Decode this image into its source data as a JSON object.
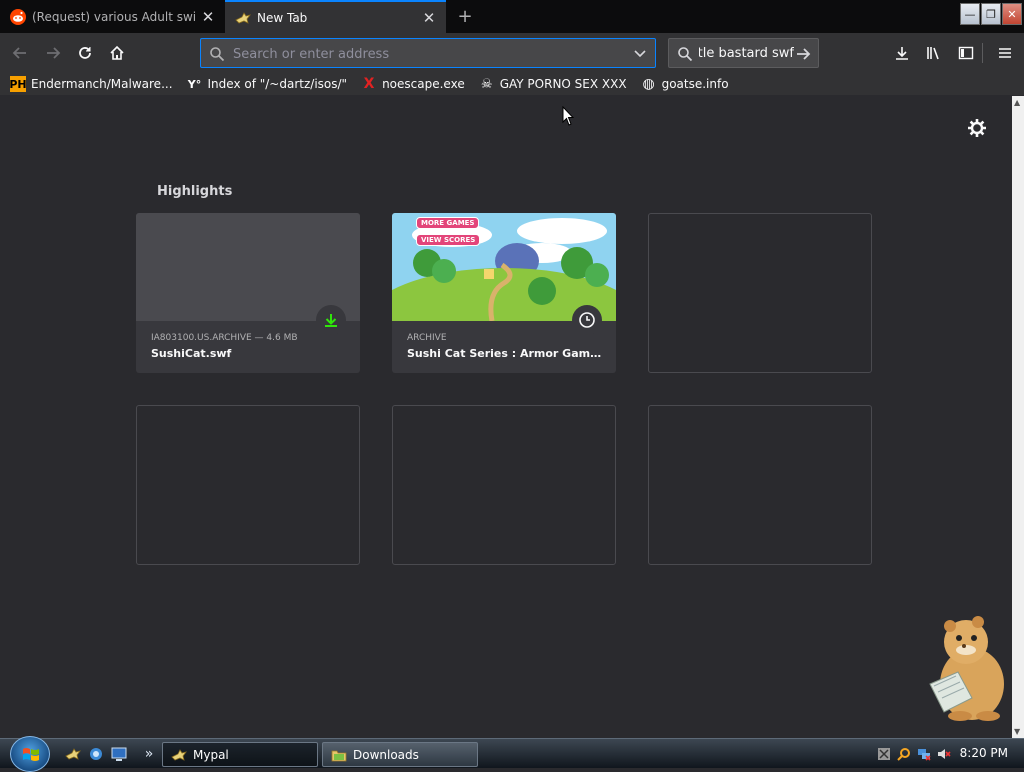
{
  "tabs": [
    {
      "title": "(Request) various Adult swim f",
      "active": false,
      "icon": "reddit-icon"
    },
    {
      "title": "New Tab",
      "active": true,
      "icon": "mypal-icon"
    }
  ],
  "window_controls": {
    "minimize": "—",
    "restore": "❐",
    "close": "✕"
  },
  "nav": {
    "urlbar_placeholder": "Search or enter address",
    "search_value": "tle bastard swf"
  },
  "bookmarks": [
    {
      "label": "Endermanch/Malware...",
      "icon_text": "PH",
      "icon": "pornhub-icon",
      "color": "#f7a000"
    },
    {
      "label": "Index of \"/~dartz/isos/\"",
      "icon_text": "Y°",
      "icon": "ycombinator-icon",
      "color": "#ffffff"
    },
    {
      "label": "noescape.exe",
      "icon_text": "X",
      "icon": "x-icon",
      "color": "#e22222"
    },
    {
      "label": "GAY PORNO SEX XXX",
      "icon_text": "☠",
      "icon": "skull-icon",
      "color": "#ffffff"
    },
    {
      "label": "goatse.info",
      "icon_text": "◍",
      "icon": "globe-icon",
      "color": "#f9f9fa"
    }
  ],
  "highlights": {
    "title": "Highlights",
    "cards": [
      {
        "meta": "IA803100.US.ARCHIVE — 4.6 MB",
        "title": "SushiCat.swf",
        "badge": "download-icon"
      },
      {
        "meta": "ARCHIVE",
        "title": "Sushi Cat Series : Armor Games :...",
        "badge": "clock-icon",
        "buttons": [
          "MORE GAMES",
          "VIEW SCORES"
        ]
      }
    ]
  },
  "taskbar": {
    "items": [
      {
        "label": "Mypal",
        "icon": "mypal-icon"
      },
      {
        "label": "Downloads",
        "icon": "folder-icon"
      }
    ],
    "chevron": "»",
    "clock": "8:20 PM"
  },
  "colors": {
    "accent": "#0a84ff",
    "download_green": "#30e60b",
    "content_bg": "#2a2a2e"
  }
}
